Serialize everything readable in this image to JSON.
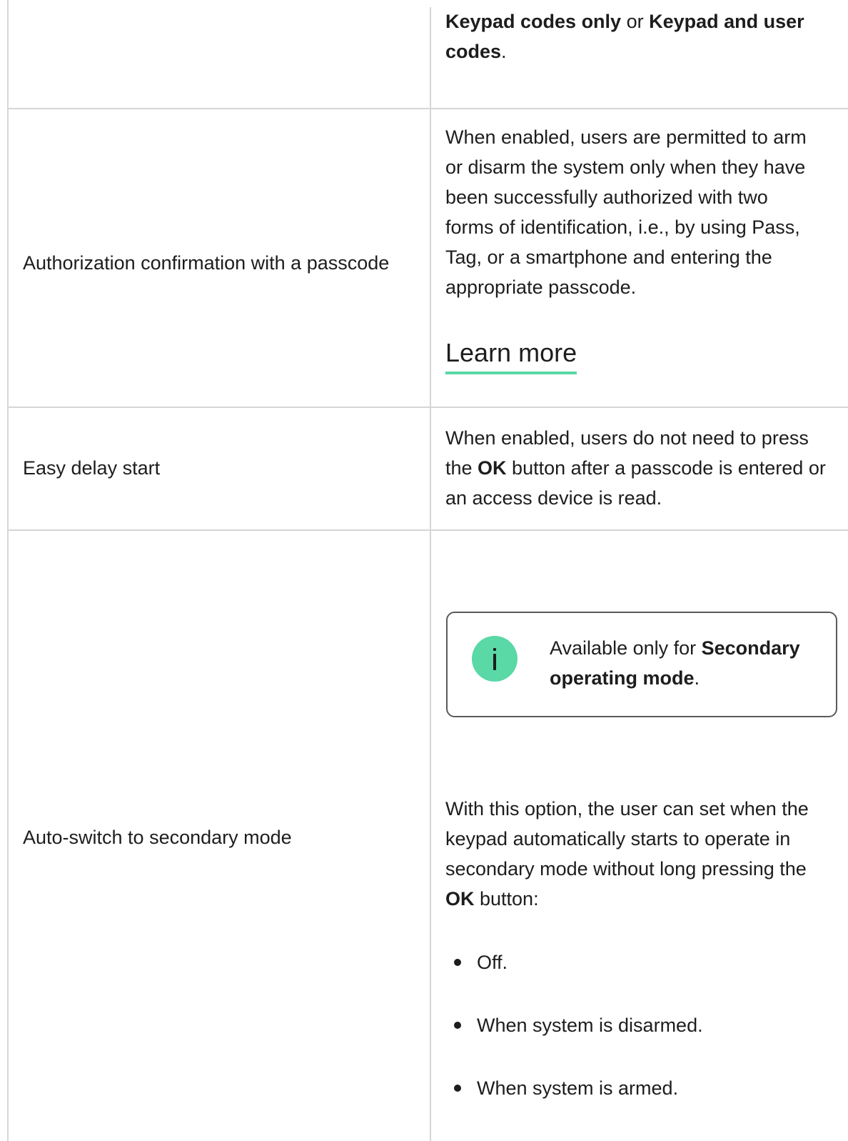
{
  "rows": [
    {
      "setting": "",
      "description": {
        "bold1": "Keypad codes only",
        "mid": " or ",
        "bold2a": "Keypad and user",
        "bold2b": "codes",
        "end": "."
      }
    },
    {
      "setting": "Authorization confirmation with a passcode",
      "description_lines": [
        "When enabled, users are permitted to arm",
        "or disarm the system only when they have",
        "been successfully authorized with two",
        "forms of identification, i.e., by using Pass,",
        "Tag, or a smartphone and entering the",
        "appropriate passcode."
      ],
      "link": "Learn more"
    },
    {
      "setting": "Easy delay start",
      "description": {
        "line1": "When enabled, users do not need to press",
        "line2_pre": "the ",
        "line2_bold": "OK",
        "line2_post": " button after a passcode is entered or",
        "line3": "an access device is read."
      }
    },
    {
      "setting": "Auto-switch to secondary mode",
      "note": {
        "icon": "info-icon",
        "pre": "Available only for ",
        "bold_a": "Secondary",
        "bold_b": "operating mode",
        "end": "."
      },
      "description": {
        "line1": "With this option, the user can set when the",
        "line2": "keypad automatically starts to operate in",
        "line3": "secondary mode without long pressing the",
        "line4_bold": "OK",
        "line4_post": " button:"
      },
      "options": [
        "Off.",
        "When system is disarmed.",
        "When system is armed."
      ]
    }
  ],
  "colors": {
    "accent": "#5ad8a6",
    "border": "#d6d6d6",
    "text": "#1d1d1d"
  }
}
